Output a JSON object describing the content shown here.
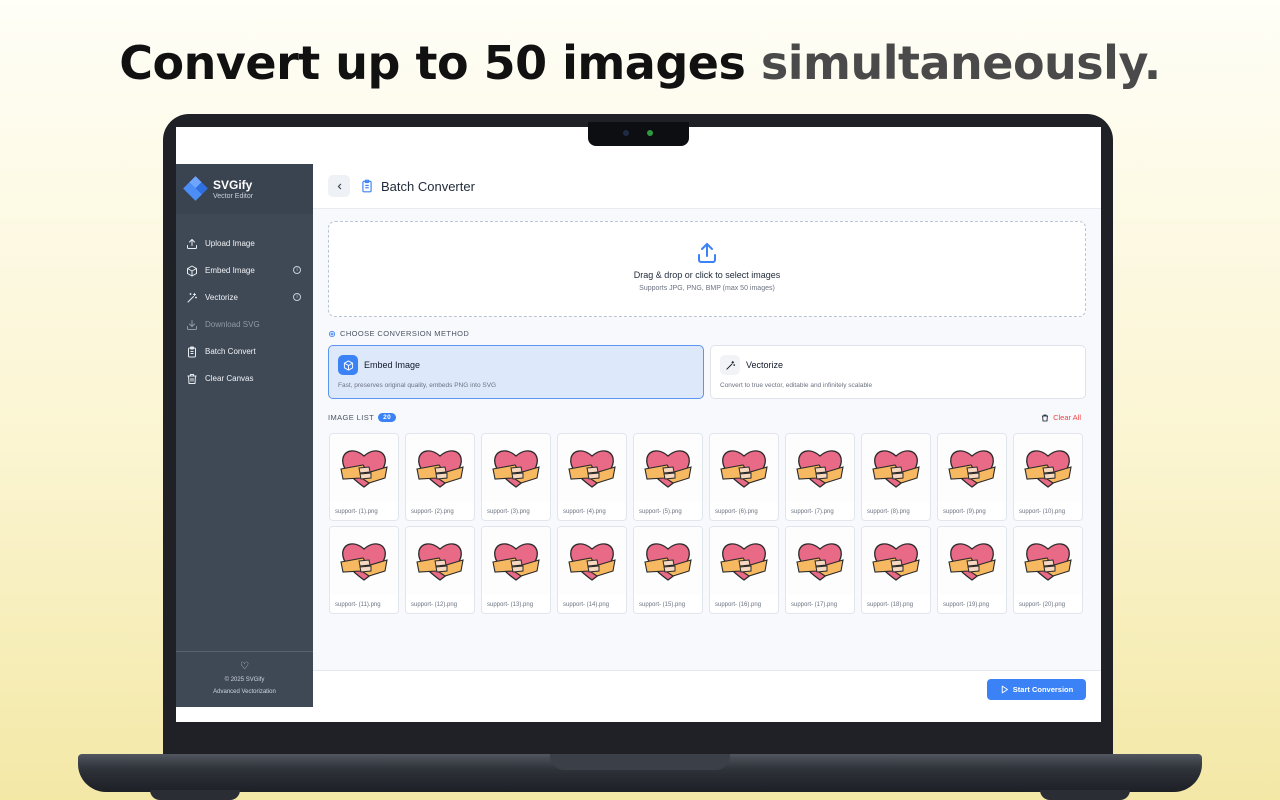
{
  "headline": {
    "part1": "Convert up to 50 images",
    "part2": " simultaneously."
  },
  "brand": {
    "name": "SVGify",
    "tagline": "Vector Editor"
  },
  "sidebar": {
    "items": [
      {
        "label": "Upload Image",
        "icon": "upload-icon",
        "disabled": false,
        "info": false
      },
      {
        "label": "Embed Image",
        "icon": "cube-icon",
        "disabled": false,
        "info": true
      },
      {
        "label": "Vectorize",
        "icon": "magic-wand-icon",
        "disabled": false,
        "info": true
      },
      {
        "label": "Download SVG",
        "icon": "download-icon",
        "disabled": true,
        "info": false
      },
      {
        "label": "Batch Convert",
        "icon": "clipboard-icon",
        "disabled": false,
        "info": false
      },
      {
        "label": "Clear Canvas",
        "icon": "trash-icon",
        "disabled": false,
        "info": false
      }
    ],
    "footer": {
      "copyright": "© 2025 SVGify",
      "subtitle": "Advanced Vectorization"
    }
  },
  "header": {
    "title": "Batch Converter"
  },
  "dropzone": {
    "title": "Drag & drop or click to select images",
    "subtitle": "Supports JPG, PNG, BMP (max 50 images)"
  },
  "method": {
    "label": "CHOOSE CONVERSION METHOD",
    "options": [
      {
        "name": "Embed Image",
        "desc": "Fast, preserves original quality, embeds PNG into SVG",
        "selected": true
      },
      {
        "name": "Vectorize",
        "desc": "Convert to true vector, editable and infinitely scalable",
        "selected": false
      }
    ]
  },
  "image_list": {
    "label": "IMAGE LIST",
    "count": "20",
    "clear_label": "Clear All",
    "files": [
      "support- (1).png",
      "support- (2).png",
      "support- (3).png",
      "support- (4).png",
      "support- (5).png",
      "support- (6).png",
      "support- (7).png",
      "support- (8).png",
      "support- (9).png",
      "support- (10).png",
      "support- (11).png",
      "support- (12).png",
      "support- (13).png",
      "support- (14).png",
      "support- (15).png",
      "support- (16).png",
      "support- (17).png",
      "support- (18).png",
      "support- (19).png",
      "support- (20).png"
    ]
  },
  "actions": {
    "start_label": "Start Conversion"
  },
  "colors": {
    "accent": "#3b82f6",
    "sidebar": "#3f4956",
    "danger": "#ef4444",
    "heart": "#e86a86",
    "hands": "#f6b860"
  }
}
